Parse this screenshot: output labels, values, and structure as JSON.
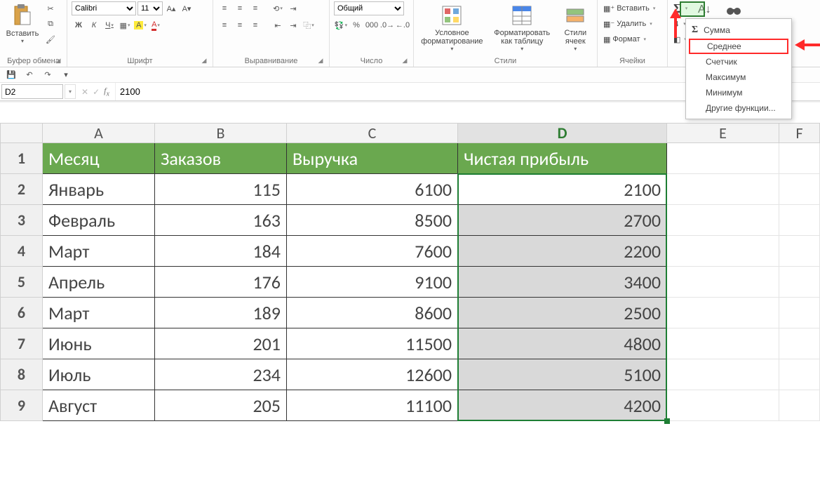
{
  "ribbon": {
    "clipboard": {
      "paste": "Вставить",
      "label": "Буфер обмена"
    },
    "font": {
      "name": "Calibri",
      "size": "11",
      "label": "Шрифт",
      "bold": "Ж",
      "italic": "К",
      "underline": "Ч"
    },
    "alignment": {
      "label": "Выравнивание"
    },
    "number": {
      "format": "Общий",
      "label": "Число"
    },
    "styles": {
      "conditional": "Условное форматирование",
      "as_table": "Форматировать как таблицу",
      "cell_styles": "Стили ячеек",
      "label": "Стили"
    },
    "cells": {
      "insert": "Вставить",
      "delete": "Удалить",
      "format": "Формат",
      "label": "Ячейки"
    },
    "autosum_menu": {
      "sum": "Сумма",
      "average": "Среднее",
      "count": "Счетчик",
      "max": "Максимум",
      "min": "Минимум",
      "more": "Другие функции..."
    }
  },
  "namebox": "D2",
  "formula": "2100",
  "columns": [
    "A",
    "B",
    "C",
    "D",
    "E",
    "F"
  ],
  "headers": {
    "A": "Месяц",
    "B": "Заказов",
    "C": "Выручка",
    "D": "Чистая прибыль"
  },
  "rows": [
    {
      "n": 2,
      "A": "Январь",
      "B": 115,
      "C": 6100,
      "D": 2100
    },
    {
      "n": 3,
      "A": "Февраль",
      "B": 163,
      "C": 8500,
      "D": 2700
    },
    {
      "n": 4,
      "A": "Март",
      "B": 184,
      "C": 7600,
      "D": 2200
    },
    {
      "n": 5,
      "A": "Апрель",
      "B": 176,
      "C": 9100,
      "D": 3400
    },
    {
      "n": 6,
      "A": "Март",
      "B": 189,
      "C": 8600,
      "D": 2500
    },
    {
      "n": 7,
      "A": "Июнь",
      "B": 201,
      "C": 11500,
      "D": 4800
    },
    {
      "n": 8,
      "A": "Июль",
      "B": 234,
      "C": 12600,
      "D": 5100
    },
    {
      "n": 9,
      "A": "Август",
      "B": 205,
      "C": 11100,
      "D": 4200
    }
  ]
}
